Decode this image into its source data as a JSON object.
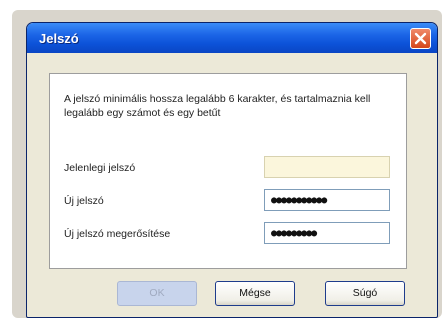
{
  "window": {
    "title": "Jelszó",
    "close_icon": "close-icon",
    "accent_color": "#0c52d8"
  },
  "dialog": {
    "message": "A jelszó minimális hossza legalább 6 karakter, és tartalmaznia kell legalább egy számot és egy betűt",
    "fields": [
      {
        "label": "Jelenlegi jelszó",
        "value": "",
        "disabled": true
      },
      {
        "label": "Új jelszó",
        "value": "●●●●●●●●●●●",
        "disabled": false
      },
      {
        "label": "Új jelszó megerősítése",
        "value": "●●●●●●●●●",
        "disabled": false
      }
    ]
  },
  "buttons": {
    "ok": {
      "label": "OK",
      "disabled": true
    },
    "cancel": {
      "label": "Mégse"
    },
    "help": {
      "label": "Súgó"
    }
  }
}
